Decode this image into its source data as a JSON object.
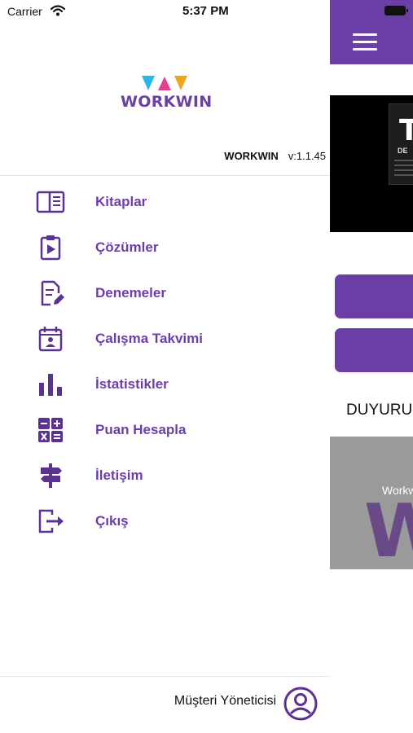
{
  "status_bar": {
    "carrier": "Carrier",
    "time": "5:37 PM"
  },
  "brand": {
    "logo_text": "WORKWIN",
    "app_name": "WORKWIN",
    "version": "v:1.1.45"
  },
  "menu": [
    {
      "label": "Kitaplar",
      "icon": "book-open-icon"
    },
    {
      "label": "Çözümler",
      "icon": "clipboard-play-icon"
    },
    {
      "label": "Denemeler",
      "icon": "document-edit-icon"
    },
    {
      "label": "Çalışma Takvimi",
      "icon": "calendar-user-icon"
    },
    {
      "label": "İstatistikler",
      "icon": "bar-chart-icon"
    },
    {
      "label": "Puan Hesapla",
      "icon": "calculator-icon"
    },
    {
      "label": "İletişim",
      "icon": "signpost-icon"
    },
    {
      "label": "Çıkış",
      "icon": "logout-icon"
    }
  ],
  "footer": {
    "label": "Müşteri Yöneticisi",
    "icon": "user-circle-icon"
  },
  "background_screen": {
    "banner_big": "T",
    "banner_small": "DE",
    "section_title": "DUYURU",
    "news_label": "Workw",
    "news_logo": "W"
  },
  "colors": {
    "accent": "#6b3fa6",
    "icon": "#5b3291",
    "news_bg": "#9a9a9a"
  }
}
